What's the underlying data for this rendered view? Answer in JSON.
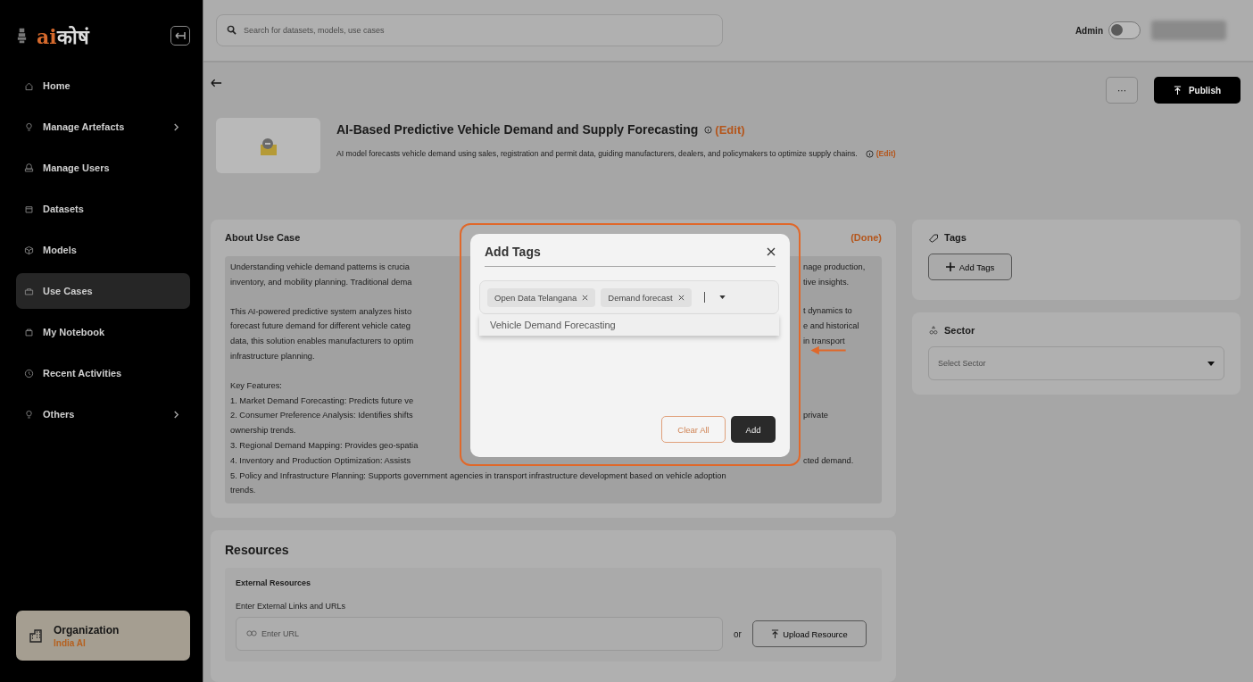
{
  "sidebar": {
    "logo": {
      "prefix": "ai",
      "suffix": "कोषं"
    },
    "items": [
      {
        "label": "Home",
        "selected": false,
        "expandable": false
      },
      {
        "label": "Manage Artefacts",
        "selected": false,
        "expandable": true
      },
      {
        "label": "Manage Users",
        "selected": false,
        "expandable": false
      },
      {
        "label": "Datasets",
        "selected": false,
        "expandable": false
      },
      {
        "label": "Models",
        "selected": false,
        "expandable": false
      },
      {
        "label": "Use Cases",
        "selected": true,
        "expandable": false
      },
      {
        "label": "My Notebook",
        "selected": false,
        "expandable": false
      },
      {
        "label": "Recent Activities",
        "selected": false,
        "expandable": false
      },
      {
        "label": "Others",
        "selected": false,
        "expandable": true
      }
    ],
    "organization": {
      "label": "Organization",
      "value": "India AI"
    }
  },
  "topbar": {
    "search": {
      "placeholder": "Search for datasets, models, use cases"
    },
    "role": "Admin",
    "toggle_on": false
  },
  "header": {
    "more": "···",
    "publish": "Publish",
    "title": "AI-Based Predictive Vehicle Demand and Supply Forecasting",
    "title_edit": "(Edit)",
    "description": "AI model forecasts vehicle demand using sales, registration and permit data, guiding manufacturers, dealers, and policymakers to optimize supply chains.",
    "description_edit": "(Edit)"
  },
  "about": {
    "title": "About Use Case",
    "action": "(Done)",
    "paragraphs": [
      [
        {
          "left": "Understanding vehicle demand patterns is crucia",
          "right": "nage production,"
        },
        {
          "left": "inventory, and mobility planning. Traditional dema",
          "right": "tive insights."
        }
      ],
      [
        {
          "left": "This AI-powered predictive system analyzes histo",
          "right": "t dynamics to"
        },
        {
          "left": "forecast future demand for different vehicle categ",
          "right": "e and historical"
        },
        {
          "left": "data, this solution enables manufacturers to optim",
          "right": "in transport"
        },
        {
          "left": "infrastructure planning."
        }
      ],
      [
        {
          "left": "Key Features:"
        },
        {
          "left": "1. Market Demand Forecasting: Predicts future ve"
        },
        {
          "left": "2. Consumer Preference Analysis: Identifies shifts",
          "right": "private"
        },
        {
          "left": "ownership trends."
        },
        {
          "left": "3. Regional Demand Mapping: Provides geo-spatia"
        },
        {
          "left": "4. Inventory and Production Optimization: Assists",
          "right": "cted demand."
        },
        {
          "left": "5. Policy and Infrastructure Planning: Supports government agencies in transport infrastructure development based on vehicle adoption"
        },
        {
          "left": "trends."
        }
      ]
    ]
  },
  "tags_card": {
    "title": "Tags",
    "button": "Add Tags"
  },
  "sector_card": {
    "title": "Sector",
    "placeholder": "Select Sector"
  },
  "resources": {
    "title": "Resources",
    "section": "External Resources",
    "label": "Enter External Links and URLs",
    "url_placeholder": "Enter URL",
    "or": "or",
    "upload": "Upload Resource"
  },
  "modal": {
    "title": "Add Tags",
    "tags": [
      "Open Data Telangana",
      "Demand forecast"
    ],
    "options": [
      "Vehicle Demand Forecasting"
    ],
    "clear": "Clear All",
    "add": "Add"
  }
}
